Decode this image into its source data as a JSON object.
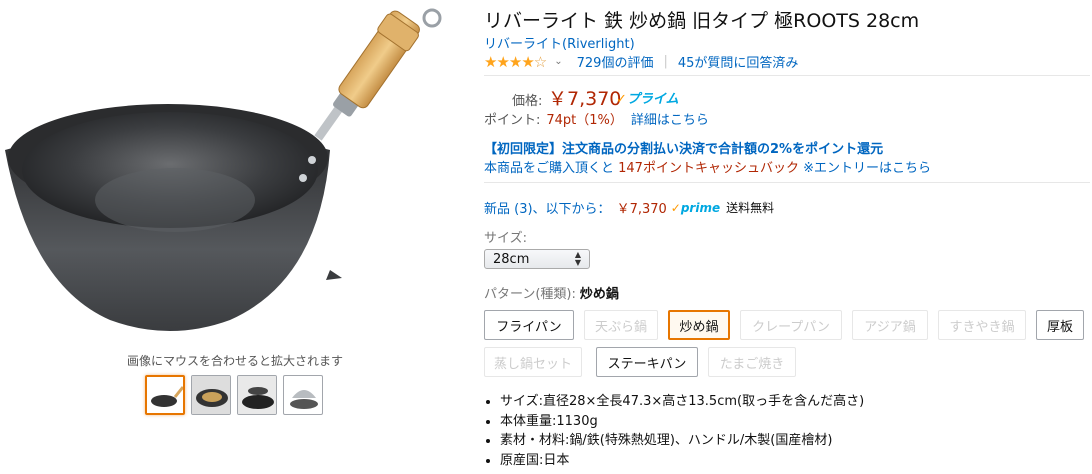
{
  "title": "リバーライト 鉄 炒め鍋 旧タイプ 極ROOTS 28cm",
  "brand": "リバーライト(Riverlight)",
  "rating": {
    "stars": 4,
    "ratings_count": "729個の評価",
    "answered": "45が質問に回答済み"
  },
  "price": {
    "label": "価格:",
    "value": "￥7,370",
    "prime": "プライム"
  },
  "points": {
    "label": "ポイント:",
    "value": "74pt（1%）",
    "details_link": "詳細はこちら"
  },
  "promo": {
    "line1": "【初回限定】注文商品の分割払い決済で合計額の2%をポイント還元",
    "line2_pre": "本商品をご購入頂くと ",
    "line2_red": "147ポイントキャッシュバック",
    "line2_post": " ※エントリーはこちら"
  },
  "new_offers": {
    "label": "新品 (3)、以下から：",
    "price": "￥7,370",
    "prime": "prime",
    "shipping": "送料無料"
  },
  "size": {
    "label": "サイズ:",
    "selected": "28cm"
  },
  "pattern": {
    "label": "パターン(種類):",
    "selected": "炒め鍋",
    "options": [
      {
        "label": "フライパン",
        "state": "avail"
      },
      {
        "label": "天ぷら鍋",
        "state": "disabled"
      },
      {
        "label": "炒め鍋",
        "state": "sel"
      },
      {
        "label": "クレープパン",
        "state": "disabled"
      },
      {
        "label": "アジア鍋",
        "state": "disabled"
      },
      {
        "label": "すきやき鍋",
        "state": "disabled"
      },
      {
        "label": "厚板",
        "state": "avail"
      },
      {
        "label": "蒸し鍋セット",
        "state": "disabled"
      },
      {
        "label": "ステーキパン",
        "state": "avail"
      },
      {
        "label": "たまご焼き",
        "state": "disabled"
      }
    ]
  },
  "bullets": [
    "サイズ:直径28×全長47.3×高さ13.5cm(取っ手を含んだ高さ)",
    "本体重量:1130g",
    "素材・材料:鍋/鉄(特殊熱処理)、ハンドル/木製(国産檜材)",
    "原産国:日本"
  ],
  "image_hint": "画像にマウスを合わせると拡大されます",
  "colors": {
    "link": "#0066c0",
    "price": "#b12704",
    "prime": "#00a8e1",
    "star": "#ffa41c",
    "selected": "#e77600"
  }
}
